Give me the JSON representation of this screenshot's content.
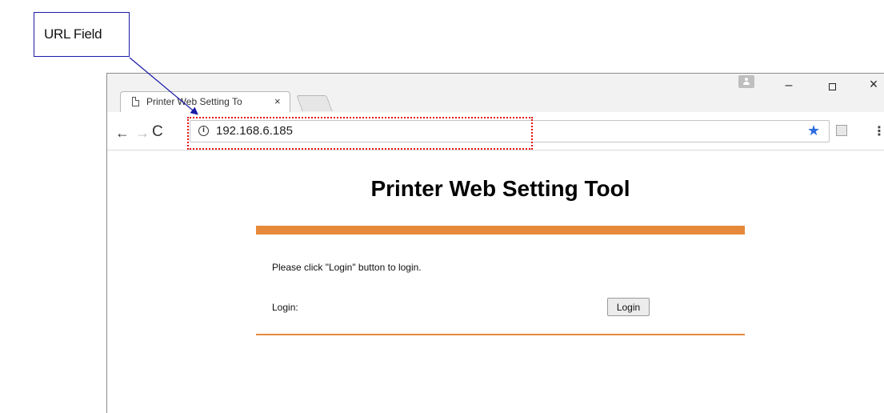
{
  "callout": {
    "label": "URL Field"
  },
  "browser": {
    "tab": {
      "title": "Printer Web Setting To",
      "close": "×"
    },
    "window_controls": {
      "minimize": "–",
      "maximize": "",
      "close": "×"
    },
    "nav": {
      "back": "←",
      "forward": "→",
      "reload": "C"
    },
    "address_bar": {
      "info_icon": "i",
      "url": "192.168.6.185",
      "bookmark_icon": "★"
    },
    "menu_icon": "⋮"
  },
  "page": {
    "title": "Printer Web Setting Tool",
    "instruction": "Please click \"Login\" button to login.",
    "login_label": "Login:",
    "login_button": "Login"
  },
  "colors": {
    "accent_bar": "#e6893a",
    "callout_border": "#1a1aa8",
    "highlight": "#e01010",
    "bookmark_star": "#2d6de0"
  }
}
